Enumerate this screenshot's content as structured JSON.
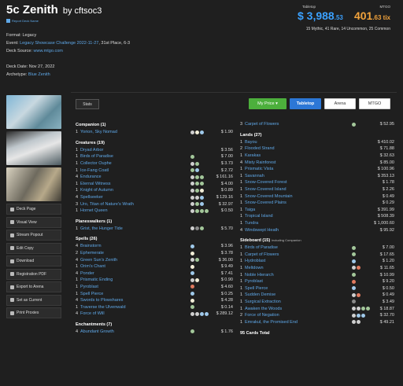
{
  "header": {
    "title": "5c Zenith",
    "author": "by cftsoc3",
    "report": "Report Deck Name"
  },
  "prices": {
    "tabletop_label": "Tabletop",
    "mtgo_label": "MTGO",
    "usd_main": "$ 3,988",
    "usd_cents": ".53",
    "tix_main": "401",
    "tix_cents": ".63 tix",
    "rarity": "15 Mythic, 41 Rare, 14 Uncommon, 25 Common"
  },
  "meta": {
    "format": "Format: Legacy",
    "event_label": "Event: ",
    "event_link": "Legacy Showcase Challenge 2022-11-27",
    "event_rest": ", 31st Place, 6-3",
    "source_label": "Deck Source: ",
    "source_link": "www.mtgo.com",
    "date": "Deck Date: Nov 27, 2022",
    "arch_label": "Archetype: ",
    "arch_link": "Blue Zenith"
  },
  "sidebar": {
    "buttons": [
      "Deck Page",
      "Visual View",
      "Stream Popout",
      "Edit Copy",
      "Download",
      "Registration PDF",
      "Export to Arena",
      "Set as Current",
      "Print Proxies"
    ]
  },
  "toolbar": {
    "stats": "Stats",
    "my_price": "My Price",
    "tabletop": "Tabletop",
    "arena": "Arena",
    "mtgo": "MTGO"
  },
  "left_sections": [
    {
      "title": "Companion (1)",
      "cards": [
        {
          "q": "1",
          "n": "Yorion, Sky Nomad",
          "mana": [
            "x",
            "w",
            "u"
          ],
          "p": "$ 1.90"
        }
      ]
    },
    {
      "title": "Creatures (19)",
      "cards": [
        {
          "q": "1",
          "n": "Dryad Arbor",
          "mana": [],
          "p": "$ 3.56"
        },
        {
          "q": "1",
          "n": "Birds of Paradise",
          "mana": [
            "g"
          ],
          "p": "$ 7.00"
        },
        {
          "q": "1",
          "n": "Collector Ouphe",
          "mana": [
            "x",
            "g"
          ],
          "p": "$ 3.73"
        },
        {
          "q": "1",
          "n": "Ice-Fang Coatl",
          "mana": [
            "g",
            "u"
          ],
          "p": "$ 2.72"
        },
        {
          "q": "4",
          "n": "Endurance",
          "mana": [
            "x",
            "g",
            "g"
          ],
          "p": "$ 161.16"
        },
        {
          "q": "1",
          "n": "Eternal Witness",
          "mana": [
            "x",
            "g",
            "g"
          ],
          "p": "$ 4.00"
        },
        {
          "q": "1",
          "n": "Knight of Autumn",
          "mana": [
            "x",
            "g",
            "w"
          ],
          "p": "$ 0.89"
        },
        {
          "q": "4",
          "n": "Spellseeker",
          "mana": [
            "x",
            "x",
            "u"
          ],
          "p": "$ 129.16"
        },
        {
          "q": "3",
          "n": "Uro, Titan of Nature's Wrath",
          "mana": [
            "x",
            "g",
            "u"
          ],
          "p": "$ 32.97"
        },
        {
          "q": "1",
          "n": "Hornet Queen",
          "mana": [
            "x",
            "g",
            "g",
            "g"
          ],
          "p": "$ 0.50"
        }
      ]
    },
    {
      "title": "Planeswalkers (1)",
      "cards": [
        {
          "q": "1",
          "n": "Grist, the Hunger Tide",
          "mana": [
            "x",
            "b",
            "g"
          ],
          "p": "$ 5.70"
        }
      ]
    },
    {
      "title": "Spells (26)",
      "cards": [
        {
          "q": "4",
          "n": "Brainstorm",
          "mana": [
            "u"
          ],
          "p": "$ 3.96"
        },
        {
          "q": "2",
          "n": "Ephemerate",
          "mana": [
            "w"
          ],
          "p": "$ 3.78"
        },
        {
          "q": "4",
          "n": "Green Sun's Zenith",
          "mana": [
            "x",
            "g"
          ],
          "p": "$ 36.00"
        },
        {
          "q": "1",
          "n": "Orim's Chant",
          "mana": [
            "w"
          ],
          "p": "$ 9.49"
        },
        {
          "q": "4",
          "n": "Ponder",
          "mana": [
            "u"
          ],
          "p": "$ 7.41"
        },
        {
          "q": "1",
          "n": "Prismatic Ending",
          "mana": [
            "x",
            "w"
          ],
          "p": "$ 0.90"
        },
        {
          "q": "1",
          "n": "Pyroblast",
          "mana": [
            "r"
          ],
          "p": "$ 4.60"
        },
        {
          "q": "1",
          "n": "Spell Pierce",
          "mana": [
            "u"
          ],
          "p": "$ 0.25"
        },
        {
          "q": "4",
          "n": "Swords to Plowshares",
          "mana": [
            "w"
          ],
          "p": "$ 4.28"
        },
        {
          "q": "1",
          "n": "Traverse the Ulvenwald",
          "mana": [
            "g"
          ],
          "p": "$ 0.14"
        },
        {
          "q": "4",
          "n": "Force of Will",
          "mana": [
            "x",
            "x",
            "u",
            "u"
          ],
          "p": "$ 289.12"
        }
      ]
    },
    {
      "title": "Enchantments (7)",
      "cards": [
        {
          "q": "4",
          "n": "Abundant Growth",
          "mana": [
            "g"
          ],
          "p": "$ 1.76"
        }
      ]
    }
  ],
  "right_top": [
    {
      "q": "3",
      "n": "Carpet of Flowers",
      "mana": [
        "g"
      ],
      "p": "$ 52.95"
    }
  ],
  "right_sections": [
    {
      "title": "Lands (27)",
      "note": "",
      "cards": [
        {
          "q": "1",
          "n": "Bayou",
          "mana": [],
          "p": "$ 410.02"
        },
        {
          "q": "2",
          "n": "Flooded Strand",
          "mana": [],
          "p": "$ 71.88"
        },
        {
          "q": "1",
          "n": "Karakas",
          "mana": [],
          "p": "$ 32.63"
        },
        {
          "q": "4",
          "n": "Misty Rainforest",
          "mana": [],
          "p": "$ 85.00"
        },
        {
          "q": "1",
          "n": "Prismatic Vista",
          "mana": [],
          "p": "$ 100.96"
        },
        {
          "q": "1",
          "n": "Savannah",
          "mana": [],
          "p": "$ 353.13"
        },
        {
          "q": "1",
          "n": "Snow-Covered Forest",
          "mana": [],
          "p": "$ 1.78"
        },
        {
          "q": "1",
          "n": "Snow-Covered Island",
          "mana": [],
          "p": "$ 2.26"
        },
        {
          "q": "1",
          "n": "Snow-Covered Mountain",
          "mana": [],
          "p": "$ 0.49"
        },
        {
          "q": "1",
          "n": "Snow-Covered Plains",
          "mana": [],
          "p": "$ 0.29"
        },
        {
          "q": "1",
          "n": "Taiga",
          "mana": [],
          "p": "$ 391.99"
        },
        {
          "q": "1",
          "n": "Tropical Island",
          "mana": [],
          "p": "$ 508.39"
        },
        {
          "q": "1",
          "n": "Tundra",
          "mana": [],
          "p": "$ 1,000.60"
        },
        {
          "q": "4",
          "n": "Windswept Heath",
          "mana": [],
          "p": "$ 95.92"
        }
      ]
    },
    {
      "title": "Sideboard (15)",
      "note": "including Companion",
      "cards": [
        {
          "q": "1",
          "n": "Birds of Paradise",
          "mana": [
            "g"
          ],
          "p": "$ 7.00"
        },
        {
          "q": "1",
          "n": "Carpet of Flowers",
          "mana": [
            "g"
          ],
          "p": "$ 17.65"
        },
        {
          "q": "1",
          "n": "Hydroblast",
          "mana": [
            "u"
          ],
          "p": "$ 1.20"
        },
        {
          "q": "1",
          "n": "Meltdown",
          "mana": [
            "x",
            "r"
          ],
          "p": "$ 11.65"
        },
        {
          "q": "1",
          "n": "Noble Hierarch",
          "mana": [
            "g"
          ],
          "p": "$ 10.99"
        },
        {
          "q": "1",
          "n": "Pyroblast",
          "mana": [
            "r"
          ],
          "p": "$ 9.20"
        },
        {
          "q": "1",
          "n": "Spell Pierce",
          "mana": [
            "u"
          ],
          "p": "$ 0.50"
        },
        {
          "q": "1",
          "n": "Sudden Demise",
          "mana": [
            "x",
            "r"
          ],
          "p": "$ 0.49"
        },
        {
          "q": "1",
          "n": "Surgical Extraction",
          "mana": [
            "b"
          ],
          "p": "$ 3.49"
        },
        {
          "q": "1",
          "n": "Awaken the Woods",
          "mana": [
            "x",
            "x",
            "g",
            "g"
          ],
          "p": "$ 18.87"
        },
        {
          "q": "2",
          "n": "Force of Negation",
          "mana": [
            "x",
            "u",
            "u"
          ],
          "p": "$ 32.70"
        },
        {
          "q": "1",
          "n": "Emrakul, the Promised End",
          "mana": [
            "x",
            "x"
          ],
          "p": "$ 49.21"
        }
      ]
    }
  ],
  "total": "95 Cards Total"
}
